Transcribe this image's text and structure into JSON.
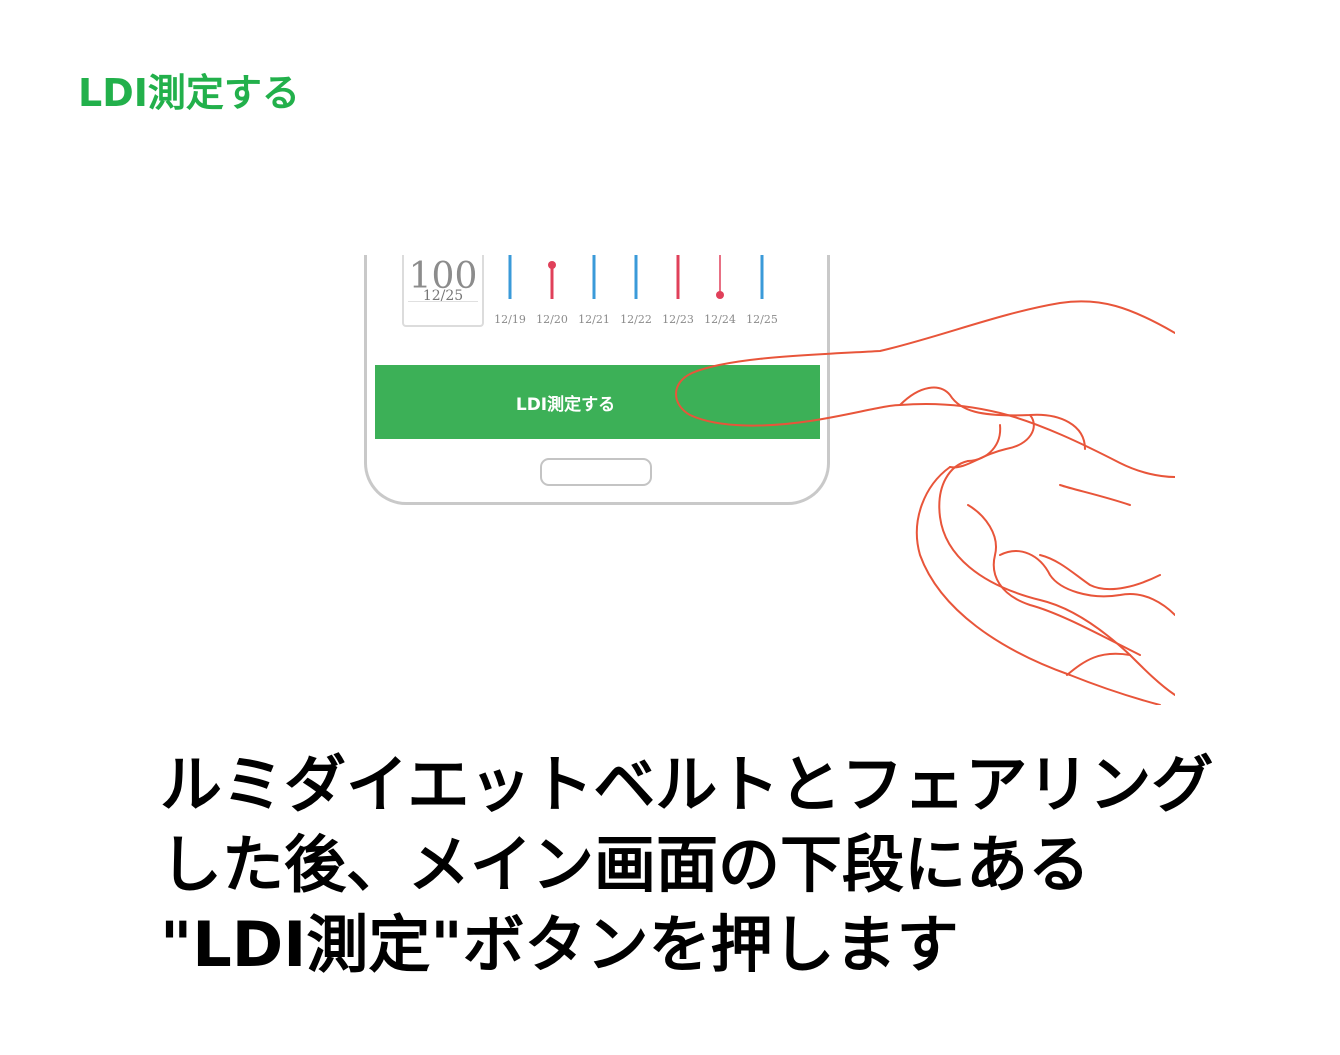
{
  "header": {
    "title": "LDI測定する"
  },
  "phone": {
    "summary_value": "100",
    "summary_date": "12/25",
    "button_label": "LDI測定する",
    "chart_dates": [
      "12/19",
      "12/20",
      "12/21",
      "12/22",
      "12/23",
      "12/24",
      "12/25"
    ],
    "colors": {
      "button": "#3cb057",
      "bar_blue": "#3a9ad9",
      "bar_red": "#e0405a",
      "hand_outline": "#e8553a"
    }
  },
  "instruction": {
    "lines": [
      "ルミダイエットベルトとフェアリング",
      "した後、メイン画面の下段にある",
      "\"LDI測定\"ボタンを押します"
    ]
  }
}
